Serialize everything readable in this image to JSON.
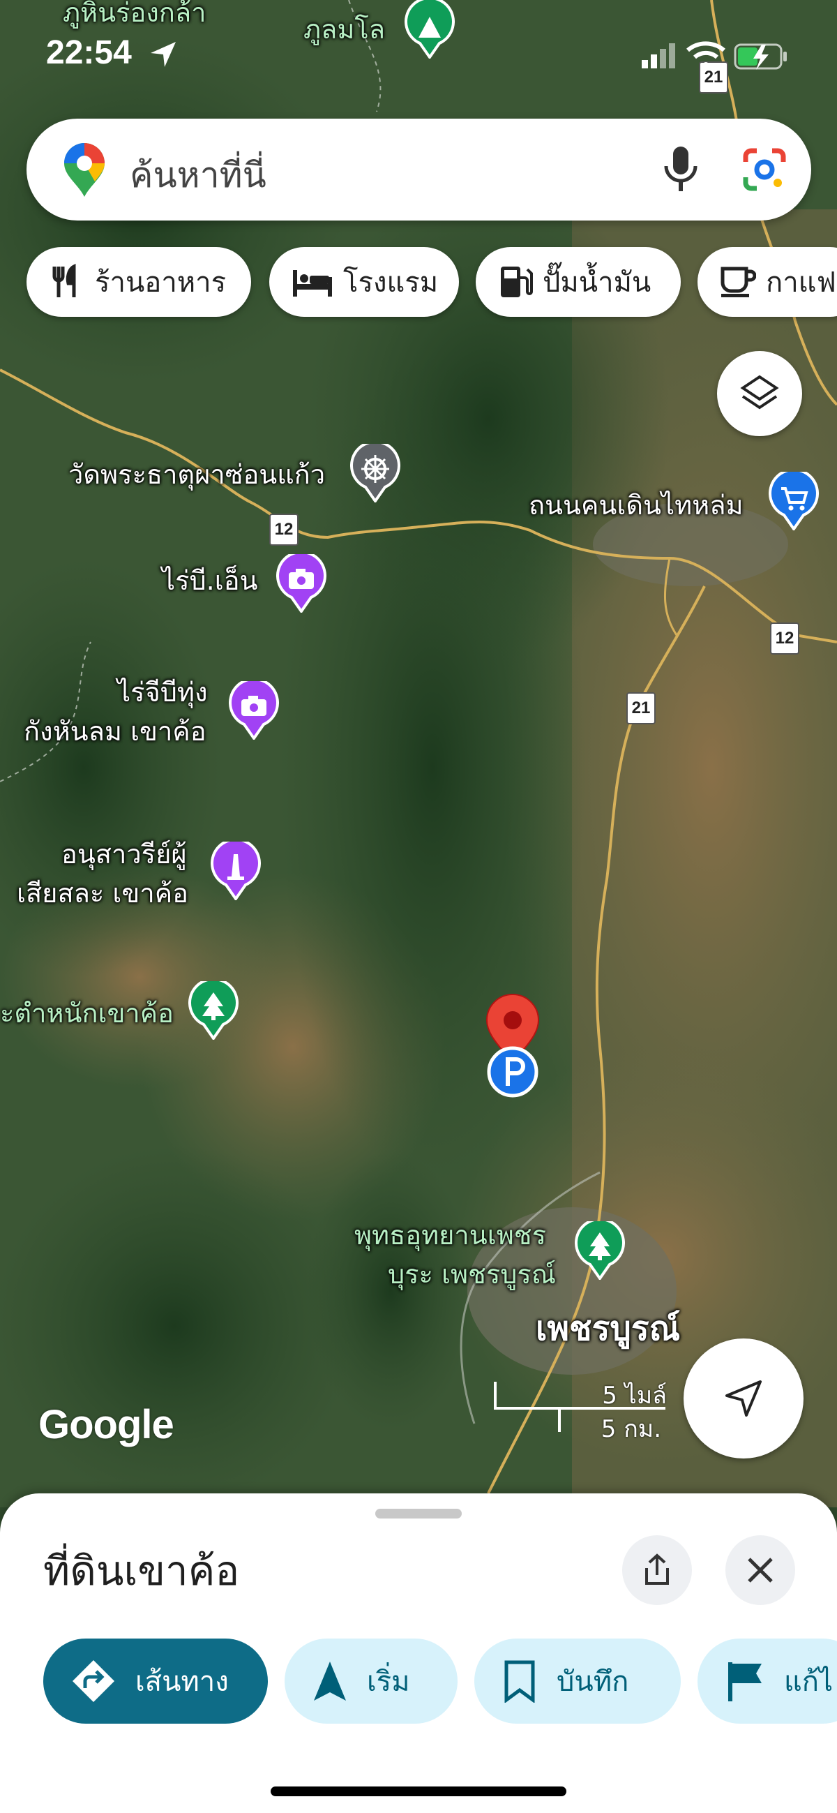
{
  "status_bar": {
    "time": "22:54"
  },
  "search": {
    "placeholder": "ค้นหาที่นี่"
  },
  "chips": [
    {
      "label": "ร้านอาหาร",
      "icon": "restaurant-icon"
    },
    {
      "label": "โรงแรม",
      "icon": "hotel-icon"
    },
    {
      "label": "ปั๊มน้ำมัน",
      "icon": "gas-station-icon"
    },
    {
      "label": "กาแฟ",
      "icon": "coffee-icon"
    }
  ],
  "map": {
    "labels": {
      "top_left_place": "ภูหินร่องกล้า",
      "top_park": "ภูลมโล",
      "temple": "วัดพระธาตุผาซ่อนแก้ว",
      "walking_street": "ถนนคนเดินไทหล่ม",
      "farm1": "ไร่บี.เอ็น",
      "farm2_line1": "ไร่จีบีทุ่ง",
      "farm2_line2": "กังหันลม เขาค้อ",
      "monument_line1": "อนุสาวรีย์ผู้",
      "monument_line2": "เสียสละ เขาค้อ",
      "palace": "ะตำหนักเขาค้อ",
      "park_line1": "พุทธอุทยานเพชร",
      "park_line2": "บุระ เพชรบูรณ์",
      "city": "เพชรบูรณ์"
    },
    "route_shields": [
      "21",
      "12",
      "12",
      "21"
    ],
    "google_logo": "Google",
    "scale_miles": "5 ไมล์",
    "scale_km": "5 กม."
  },
  "sheet": {
    "title": "ที่ดินเขาค้อ",
    "actions": [
      {
        "label": "เส้นทาง",
        "icon": "directions-icon"
      },
      {
        "label": "เริ่ม",
        "icon": "navigation-arrow-icon"
      },
      {
        "label": "บันทึก",
        "icon": "bookmark-icon"
      },
      {
        "label": "แก้ไ",
        "icon": "flag-icon"
      }
    ]
  },
  "colors": {
    "accent": "#0e6c87",
    "action_bg": "#d7f2fb",
    "pin_red": "#ea4335",
    "poi_purple": "#a142f4",
    "poi_green": "#0f9d58",
    "poi_blue": "#1a73e8",
    "poi_gray": "#5f6368"
  }
}
